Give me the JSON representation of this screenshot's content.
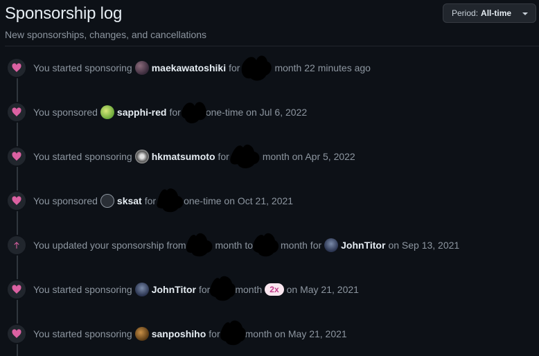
{
  "header": {
    "title": "Sponsorship log",
    "subtitle": "New sponsorships, changes, and cancellations"
  },
  "period": {
    "label": "Period:",
    "value": "All-time"
  },
  "colors": {
    "heart": "#db61a2",
    "accent_pill_bg": "#f9e6ef",
    "accent_pill_fg": "#bf3989"
  },
  "entries": [
    {
      "icon": "heart-icon",
      "prefix": "You started sponsoring",
      "user": "maekawatoshiki",
      "mid": "for",
      "suffix": "month 22 minutes ago"
    },
    {
      "icon": "heart-icon",
      "prefix": "You sponsored",
      "user": "sapphi-red",
      "mid": "for",
      "suffix": "one-time on Jul 6, 2022"
    },
    {
      "icon": "heart-icon",
      "prefix": "You started sponsoring",
      "user": "hkmatsumoto",
      "mid": "for",
      "suffix": "month on Apr 5, 2022"
    },
    {
      "icon": "heart-icon",
      "prefix": "You sponsored",
      "user": "sksat",
      "mid": "for",
      "suffix": "one-time on Oct 21, 2021"
    },
    {
      "icon": "arrow-up-icon",
      "prefix": "You updated your sponsorship from",
      "mid1": "month to",
      "mid2": "month for",
      "user": "JohnTitor",
      "suffix": "on Sep 13, 2021"
    },
    {
      "icon": "heart-icon",
      "prefix": "You started sponsoring",
      "user": "JohnTitor",
      "mid": "for",
      "suffix": "month",
      "pill": "2x",
      "suffix2": "on May 21, 2021"
    },
    {
      "icon": "heart-icon",
      "prefix": "You started sponsoring",
      "user": "sanposhiho",
      "mid": "for",
      "suffix": "month on May 21, 2021"
    }
  ]
}
